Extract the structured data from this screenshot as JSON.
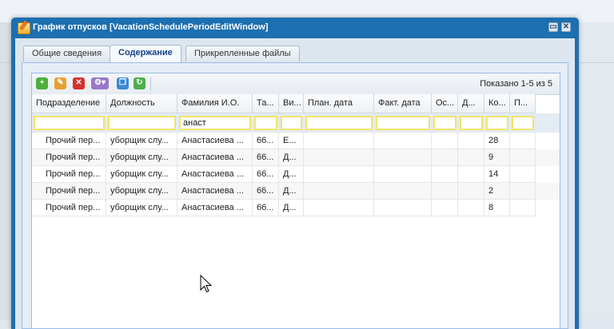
{
  "window": {
    "title": "График отпусков [VacationSchedulePeriodEditWindow]",
    "tools": {
      "restore": "▭",
      "close": "✕"
    }
  },
  "tabs": [
    {
      "label": "Общие сведения",
      "active": false
    },
    {
      "label": "Содержание",
      "active": true
    },
    {
      "label": "Прикрепленные файлы",
      "active": false
    }
  ],
  "toolbar": {
    "buttons": [
      {
        "icon": "add-icon",
        "color": "#4caf3a"
      },
      {
        "icon": "edit-icon",
        "color": "#e8a030"
      },
      {
        "icon": "delete-icon",
        "color": "#d9302a"
      },
      {
        "icon": "actions-menu-icon",
        "color": "#9a78c8"
      },
      {
        "icon": "copy-icon",
        "color": "#3a88d0"
      },
      {
        "icon": "refresh-icon",
        "color": "#4fae4a"
      }
    ],
    "paging_text": "Показано 1-5 из 5"
  },
  "grid": {
    "columns": [
      "Подразделение",
      "Должность",
      "Фамилия И.О.",
      "Та...",
      "Ви...",
      "План. дата",
      "Факт. дата",
      "Ос...",
      "Д...",
      "Ко...",
      "П..."
    ],
    "filters": [
      "",
      "",
      "анаст",
      "",
      "",
      "",
      "",
      "",
      "",
      "",
      ""
    ],
    "rows": [
      [
        "Прочий пер...",
        "уборщик слу...",
        "Анастасиева ...",
        "66...",
        "Е...",
        "",
        "",
        "",
        "",
        "28",
        ""
      ],
      [
        "Прочий пер...",
        "уборщик слу...",
        "Анастасиева ...",
        "66...",
        "Д...",
        "",
        "",
        "",
        "",
        "9",
        ""
      ],
      [
        "Прочий пер...",
        "уборщик слу...",
        "Анастасиева ...",
        "66...",
        "Д...",
        "",
        "",
        "",
        "",
        "14",
        ""
      ],
      [
        "Прочий пер...",
        "уборщик слу...",
        "Анастасиева ...",
        "66...",
        "Д...",
        "",
        "",
        "",
        "",
        "2",
        ""
      ],
      [
        "Прочий пер...",
        "уборщик слу...",
        "Анастасиева ...",
        "66...",
        "Д...",
        "",
        "",
        "",
        "",
        "8",
        ""
      ]
    ]
  }
}
